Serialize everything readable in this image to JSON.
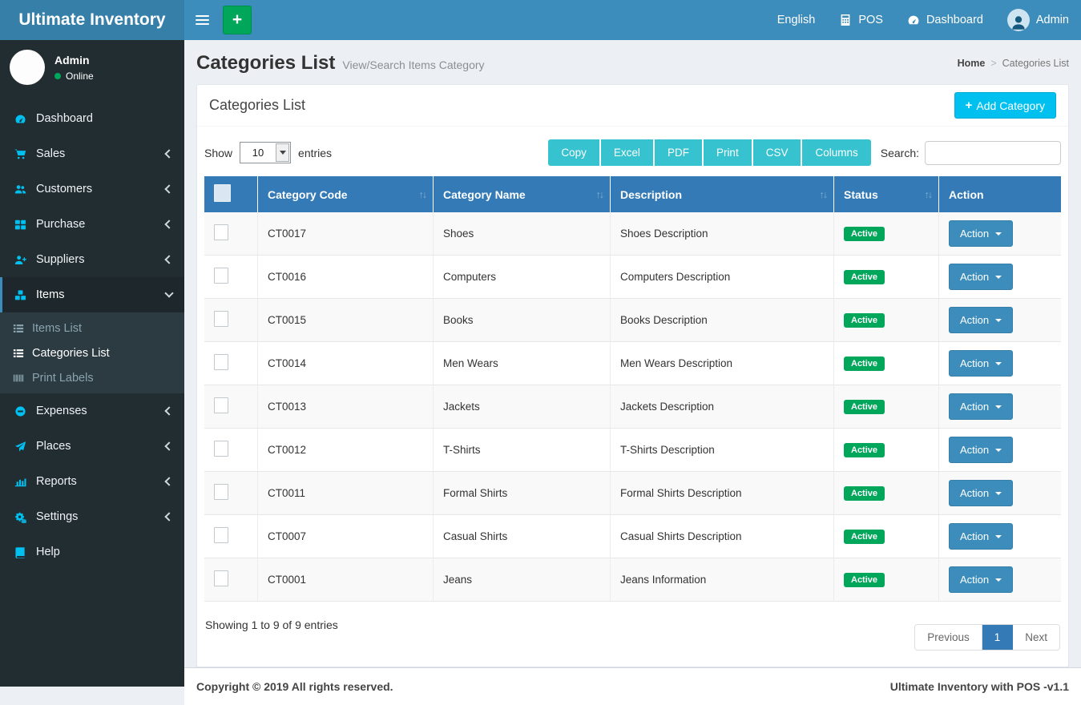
{
  "navbar": {
    "brand": "Ultimate Inventory",
    "menu": [
      {
        "label": "English",
        "icon": null
      },
      {
        "label": "POS",
        "icon": "calculator-icon"
      },
      {
        "label": "Dashboard",
        "icon": "dashboard-icon"
      },
      {
        "label": "Admin",
        "icon": "user-avatar"
      }
    ]
  },
  "sidebar": {
    "user": {
      "name": "Admin",
      "status": "Online"
    },
    "items": [
      {
        "label": "Dashboard",
        "icon": "dashboard-icon",
        "chevron": null,
        "active": false
      },
      {
        "label": "Sales",
        "icon": "cart-icon",
        "chevron": "left",
        "active": false
      },
      {
        "label": "Customers",
        "icon": "users-icon",
        "chevron": "left",
        "active": false
      },
      {
        "label": "Purchase",
        "icon": "grid-icon",
        "chevron": "left",
        "active": false
      },
      {
        "label": "Suppliers",
        "icon": "user-plus-icon",
        "chevron": "left",
        "active": false
      },
      {
        "label": "Items",
        "icon": "cubes-icon",
        "chevron": "down",
        "active": true,
        "submenu": [
          {
            "label": "Items List",
            "icon": "list-icon",
            "active": false
          },
          {
            "label": "Categories List",
            "icon": "list-icon",
            "active": true
          },
          {
            "label": "Print Labels",
            "icon": "barcode-icon",
            "active": false
          }
        ]
      },
      {
        "label": "Expenses",
        "icon": "minus-circle-icon",
        "chevron": "left",
        "active": false
      },
      {
        "label": "Places",
        "icon": "paper-plane-icon",
        "chevron": "left",
        "active": false
      },
      {
        "label": "Reports",
        "icon": "bar-chart-icon",
        "chevron": "left",
        "active": false
      },
      {
        "label": "Settings",
        "icon": "gears-icon",
        "chevron": "left",
        "active": false
      },
      {
        "label": "Help",
        "icon": "book-icon",
        "chevron": null,
        "active": false
      }
    ]
  },
  "page": {
    "title": "Categories List",
    "subtitle": "View/Search Items Category",
    "breadcrumb": {
      "home": "Home",
      "separator": ">",
      "current": "Categories List"
    }
  },
  "panel": {
    "title": "Categories List",
    "add_button": "Add Category",
    "show_label": "Show",
    "page_length": "10",
    "entries_label": "entries",
    "export_buttons": [
      "Copy",
      "Excel",
      "PDF",
      "Print",
      "CSV",
      "Columns"
    ],
    "search_label": "Search:",
    "search_value": "",
    "info": "Showing 1 to 9 of 9 entries",
    "pagination": {
      "previous": "Previous",
      "active_page": "1",
      "next": "Next"
    }
  },
  "table": {
    "columns": [
      "Category Code",
      "Category Name",
      "Description",
      "Status",
      "Action"
    ],
    "sortable": [
      true,
      true,
      true,
      true,
      false
    ],
    "action_label": "Action",
    "rows": [
      {
        "code": "CT0017",
        "name": "Shoes",
        "description": "Shoes Description",
        "status": "Active"
      },
      {
        "code": "CT0016",
        "name": "Computers",
        "description": "Computers Description",
        "status": "Active"
      },
      {
        "code": "CT0015",
        "name": "Books",
        "description": "Books Description",
        "status": "Active"
      },
      {
        "code": "CT0014",
        "name": "Men Wears",
        "description": "Men Wears Description",
        "status": "Active"
      },
      {
        "code": "CT0013",
        "name": "Jackets",
        "description": "Jackets Description",
        "status": "Active"
      },
      {
        "code": "CT0012",
        "name": "T-Shirts",
        "description": "T-Shirts Description",
        "status": "Active"
      },
      {
        "code": "CT0011",
        "name": "Formal Shirts",
        "description": "Formal Shirts Description",
        "status": "Active"
      },
      {
        "code": "CT0007",
        "name": "Casual Shirts",
        "description": "Casual Shirts Description",
        "status": "Active"
      },
      {
        "code": "CT0001",
        "name": "Jeans",
        "description": "Jeans Information",
        "status": "Active"
      }
    ]
  },
  "footer": {
    "left": "Copyright © 2019 All rights reserved.",
    "right": "Ultimate Inventory with POS -v1.1"
  },
  "colors": {
    "navbar": "#3c8dbc",
    "logo_bg": "#367fa9",
    "sidebar_bg": "#222d32",
    "submenu_bg": "#2c3b41",
    "sidebar_icon": "#00c0ef",
    "table_header": "#337ab7",
    "teal_button": "#36c2ce",
    "aqua_button": "#00c0ef",
    "green_badge": "#00a65a",
    "action_button": "#3c8dbc",
    "content_bg": "#ecf0f5"
  }
}
